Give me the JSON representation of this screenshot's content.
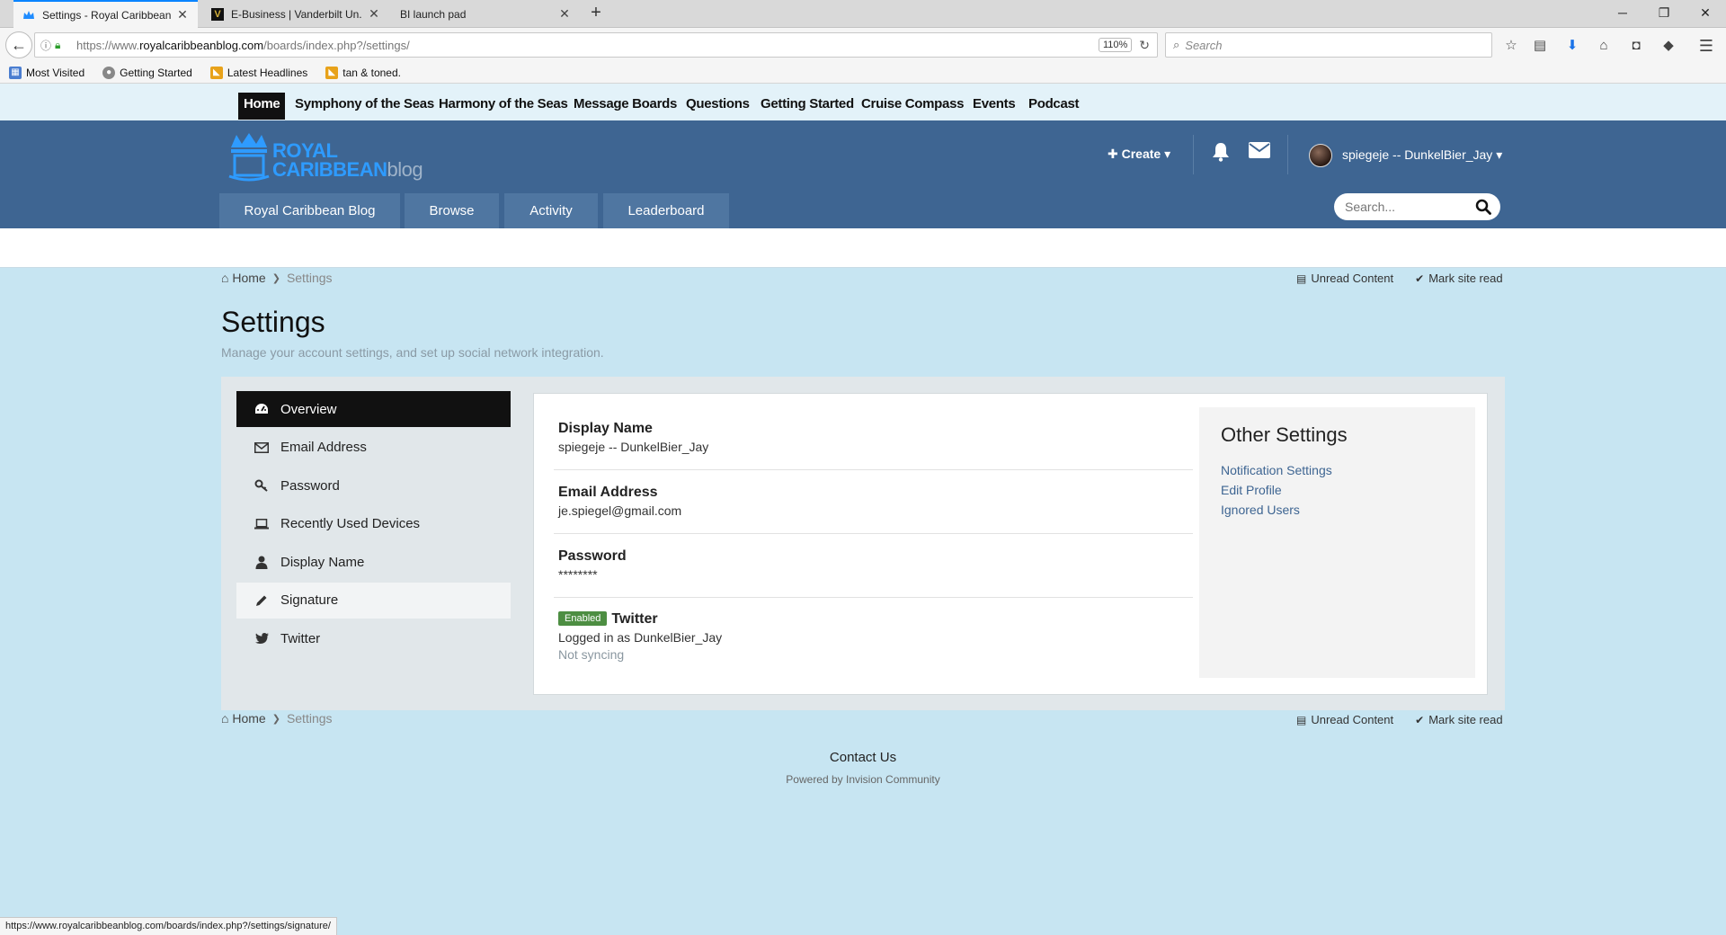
{
  "browser": {
    "tabs": [
      {
        "title": "Settings - Royal Caribbean...",
        "active": true
      },
      {
        "title": "E-Business | Vanderbilt Un...",
        "active": false
      },
      {
        "title": "BI launch pad",
        "active": false
      }
    ],
    "url_prefix": "https://www.",
    "url_domain": "royalcaribbeanblog.com",
    "url_path": "/boards/index.php?/settings/",
    "zoom": "110%",
    "search_placeholder": "Search",
    "bookmarks": [
      "Most Visited",
      "Getting Started",
      "Latest Headlines",
      "tan & toned."
    ],
    "status_url": "https://www.royalcaribbeanblog.com/boards/index.php?/settings/signature/"
  },
  "site": {
    "top_nav": [
      "Home",
      "Symphony of the Seas",
      "Harmony of the Seas",
      "Message Boards",
      "Questions",
      "Getting Started",
      "Cruise Compass",
      "Events",
      "Podcast"
    ],
    "logo_line1": "ROYAL",
    "logo_line2": "CARIBBEAN",
    "logo_line2_suffix": "blog",
    "create_label": "Create",
    "username": "spiegeje -- DunkelBier_Jay",
    "sub_nav": [
      "Royal Caribbean Blog",
      "Browse",
      "Activity",
      "Leaderboard"
    ],
    "search_placeholder": "Search...",
    "accent": "#3e6592"
  },
  "breadcrumb": {
    "home": "Home",
    "current": "Settings"
  },
  "quick_links": {
    "unread": "Unread Content",
    "mark_read": "Mark site read"
  },
  "page": {
    "title": "Settings",
    "subtitle": "Manage your account settings, and set up social network integration."
  },
  "menu": [
    {
      "label": "Overview",
      "icon": "dashboard-icon"
    },
    {
      "label": "Email Address",
      "icon": "envelope-icon"
    },
    {
      "label": "Password",
      "icon": "key-icon"
    },
    {
      "label": "Recently Used Devices",
      "icon": "laptop-icon"
    },
    {
      "label": "Display Name",
      "icon": "user-icon"
    },
    {
      "label": "Signature",
      "icon": "pencil-icon"
    },
    {
      "label": "Twitter",
      "icon": "twitter-icon"
    }
  ],
  "overview": {
    "display_name_label": "Display Name",
    "display_name_value": "spiegeje -- DunkelBier_Jay",
    "email_label": "Email Address",
    "email_value": "je.spiegel@gmail.com",
    "password_label": "Password",
    "password_value": "********",
    "twitter_badge": "Enabled",
    "twitter_label": "Twitter",
    "twitter_status": "Logged in as DunkelBier_Jay",
    "twitter_sync": "Not syncing",
    "badge_color": "#4d8e42"
  },
  "other_settings": {
    "title": "Other Settings",
    "links": [
      "Notification Settings",
      "Edit Profile",
      "Ignored Users"
    ]
  },
  "footer": {
    "contact": "Contact Us",
    "powered": "Powered by Invision Community"
  }
}
